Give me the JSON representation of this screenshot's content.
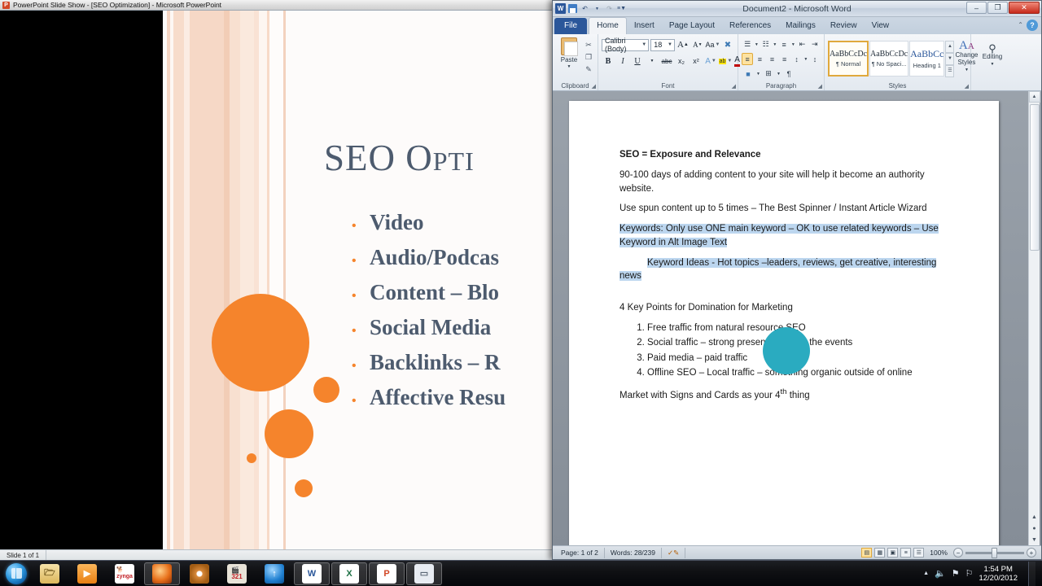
{
  "powerpoint": {
    "titlebar": "PowerPoint Slide Show - [SEO Optimization] - Microsoft PowerPoint",
    "app_icon": "P",
    "slide": {
      "title": "SEO Opti",
      "bullets": [
        "Video",
        "Audio/Podcas",
        "Content – Blo",
        "Social Media",
        "Backlinks – R",
        "Affective Resu"
      ],
      "bullet_marker": "•",
      "title_color": "#4d5b6e",
      "accent_color": "#f5842c"
    },
    "statusbar": {
      "slide_counter": "Slide 1 of 1"
    }
  },
  "word": {
    "titlebar": {
      "title": "Document2  -  Microsoft Word",
      "app_icon": "W",
      "quick_access": [
        "save-icon",
        "undo-icon",
        "redo-icon",
        "customize-icon"
      ],
      "minimize": "–",
      "maximize": "❐",
      "close": "✕"
    },
    "tabs": [
      {
        "label": "File",
        "active": false,
        "kind": "file"
      },
      {
        "label": "Home",
        "active": true,
        "kind": "normal"
      },
      {
        "label": "Insert",
        "active": false,
        "kind": "normal"
      },
      {
        "label": "Page Layout",
        "active": false,
        "kind": "normal"
      },
      {
        "label": "References",
        "active": false,
        "kind": "normal"
      },
      {
        "label": "Mailings",
        "active": false,
        "kind": "normal"
      },
      {
        "label": "Review",
        "active": false,
        "kind": "normal"
      },
      {
        "label": "View",
        "active": false,
        "kind": "normal"
      }
    ],
    "help_label": "?",
    "collapse_ribbon": "⌃",
    "ribbon": {
      "clipboard": {
        "label": "Clipboard",
        "paste_label": "Paste",
        "cut": "✂",
        "copy": "❐",
        "format_painter": "✎"
      },
      "font": {
        "label": "Font",
        "font_name": "Calibri (Body)",
        "font_size": "18",
        "grow_font": "A",
        "shrink_font": "A",
        "change_case": "Aa",
        "clear_formatting": "⌧",
        "bold": "B",
        "italic": "I",
        "underline": "U",
        "strikethrough": "abc",
        "subscript": "x₂",
        "superscript": "x²",
        "text_effects": "A",
        "highlight": "ab",
        "font_color": "A"
      },
      "paragraph": {
        "label": "Paragraph",
        "bullets": "☰",
        "numbering": "☷",
        "multilevel": "≡",
        "decrease_indent": "⇤",
        "increase_indent": "⇥",
        "sort": "↕",
        "show_marks": "¶",
        "align_left": "≡",
        "align_center": "≡",
        "align_right": "≡",
        "justify": "≡",
        "line_spacing": "↕",
        "shading": "■",
        "borders": "⊞"
      },
      "styles": {
        "label": "Styles",
        "items": [
          {
            "preview": "AaBbCcDc",
            "name": "¶ Normal",
            "selected": true
          },
          {
            "preview": "AaBbCcDc",
            "name": "¶ No Spaci...",
            "selected": false
          },
          {
            "preview": "AaBbCс",
            "name": "Heading 1",
            "selected": false
          }
        ],
        "change_styles": "Change Styles"
      },
      "editing": {
        "label": "Editing",
        "button": "Editing",
        "icon": "\u0001"
      }
    },
    "document": {
      "paragraphs": [
        {
          "type": "heading",
          "text": "SEO = Exposure and Relevance",
          "highlighted": false
        },
        {
          "type": "body",
          "text": "90-100 days of adding content to your site will help it become an authority website.",
          "highlighted": false
        },
        {
          "type": "body",
          "text": "Use spun content up to 5 times – The Best Spinner / Instant Article Wizard",
          "highlighted": false
        },
        {
          "type": "body",
          "text": "Keywords: Only use ONE main keyword – OK to use related keywords – Use Keyword in Alt Image Text",
          "highlighted": true
        },
        {
          "type": "body-indent",
          "text": "Keyword Ideas - Hot topics –leaders, reviews, get creative, interesting news",
          "highlighted": true
        },
        {
          "type": "body",
          "text": "4 Key Points for Domination for Marketing",
          "highlighted": false
        }
      ],
      "numbered_list": [
        "Free traffic from natural resource SEO",
        "Social traffic – strong presence – be at the events",
        "Paid media – paid traffic",
        "Offline SEO – Local traffic – something organic outside of online"
      ],
      "closing_paragraph_pre": "Market with Signs and Cards as your 4",
      "closing_paragraph_sup": "th",
      "closing_paragraph_post": " thing",
      "selection_color": "#bcd6ef",
      "teal_shape_color": "#2aabc0"
    },
    "statusbar": {
      "page": "Page: 1 of 2",
      "words": "Words: 28/239",
      "proofing": "proofing-icon",
      "zoom": "100%",
      "zoom_out": "−",
      "zoom_in": "+",
      "views": [
        "print-layout",
        "full-screen-reading",
        "web-layout",
        "outline",
        "draft"
      ]
    }
  },
  "taskbar": {
    "start_label": "start-orb",
    "items": [
      {
        "name": "windows-explorer",
        "glyph": "🗀",
        "color": "#e8c06a",
        "open": false
      },
      {
        "name": "media-player",
        "glyph": "▶",
        "color": "#f0922c",
        "open": false
      },
      {
        "name": "zynga",
        "glyph": "zynga",
        "color": "#c22026",
        "open": false
      },
      {
        "name": "firefox",
        "glyph": "●",
        "color": "#e86a13",
        "open": true
      },
      {
        "name": "dvd-burner",
        "glyph": "◎",
        "color": "#d8893a",
        "open": false
      },
      {
        "name": "video-editor",
        "glyph": "321",
        "color": "#d8cfc0",
        "open": false
      },
      {
        "name": "uploader",
        "glyph": "↑",
        "color": "#2f9ae0",
        "open": false
      },
      {
        "name": "microsoft-word",
        "glyph": "W",
        "color": "#2b579a",
        "open": true
      },
      {
        "name": "microsoft-excel",
        "glyph": "X",
        "color": "#1e7145",
        "open": true
      },
      {
        "name": "microsoft-powerpoint",
        "glyph": "P",
        "color": "#d24726",
        "open": true
      },
      {
        "name": "camtasia",
        "glyph": "⬜",
        "color": "#cfd6de",
        "open": true
      }
    ],
    "tray": {
      "show_hidden": "▲",
      "volume": "🔊",
      "network": "⚑",
      "action_center": "⚑",
      "time": "1:54 PM",
      "date": "12/20/2012"
    }
  }
}
